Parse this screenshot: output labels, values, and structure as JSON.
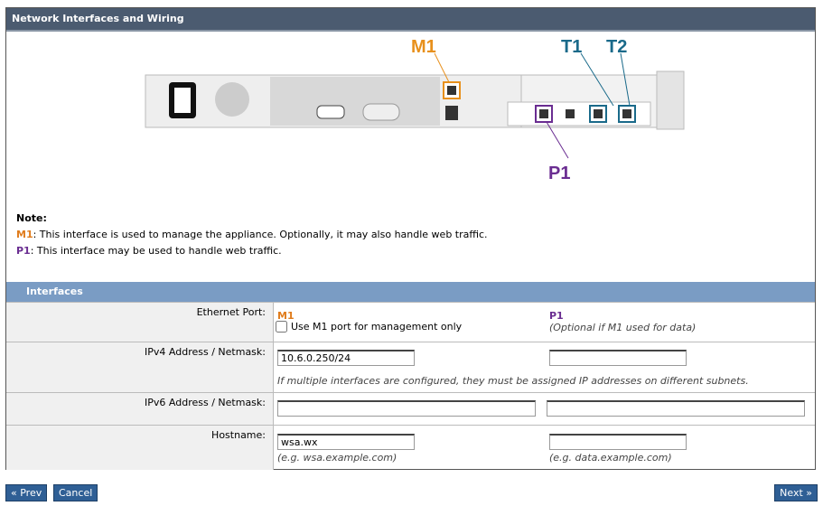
{
  "header": {
    "title": "Network Interfaces and Wiring"
  },
  "diagram": {
    "m1": "M1",
    "t1": "T1",
    "t2": "T2",
    "p1": "P1",
    "colors": {
      "m1": "#e8901c",
      "t": "#1a6a8a",
      "p1": "#6a2d91"
    }
  },
  "note": {
    "title": "Note:",
    "m1_label": "M1",
    "m1_text": ": This interface is used to manage the appliance. Optionally, it may also handle web traffic.",
    "p1_label": "P1",
    "p1_text": ": This interface may be used to handle web traffic."
  },
  "interfaces": {
    "title": "Interfaces",
    "ethernet": {
      "label": "Ethernet Port:",
      "m1": "M1",
      "mgmt_only": "Use M1 port for management only",
      "mgmt_checked": false,
      "p1": "P1",
      "p1_hint": "(Optional if M1 used for data)"
    },
    "ipv4": {
      "label": "IPv4 Address / Netmask:",
      "m1_value": "10.6.0.250/24",
      "p1_value": "",
      "hint": "If multiple interfaces are configured, they must be assigned IP addresses on different subnets."
    },
    "ipv6": {
      "label": "IPv6 Address / Netmask:",
      "m1_value": "",
      "p1_value": ""
    },
    "hostname": {
      "label": "Hostname:",
      "m1_value": "wsa.wx",
      "m1_hint": "(e.g. wsa.example.com)",
      "p1_value": "",
      "p1_hint": "(e.g. data.example.com)"
    }
  },
  "buttons": {
    "prev": "« Prev",
    "cancel": "Cancel",
    "next": "Next »"
  }
}
